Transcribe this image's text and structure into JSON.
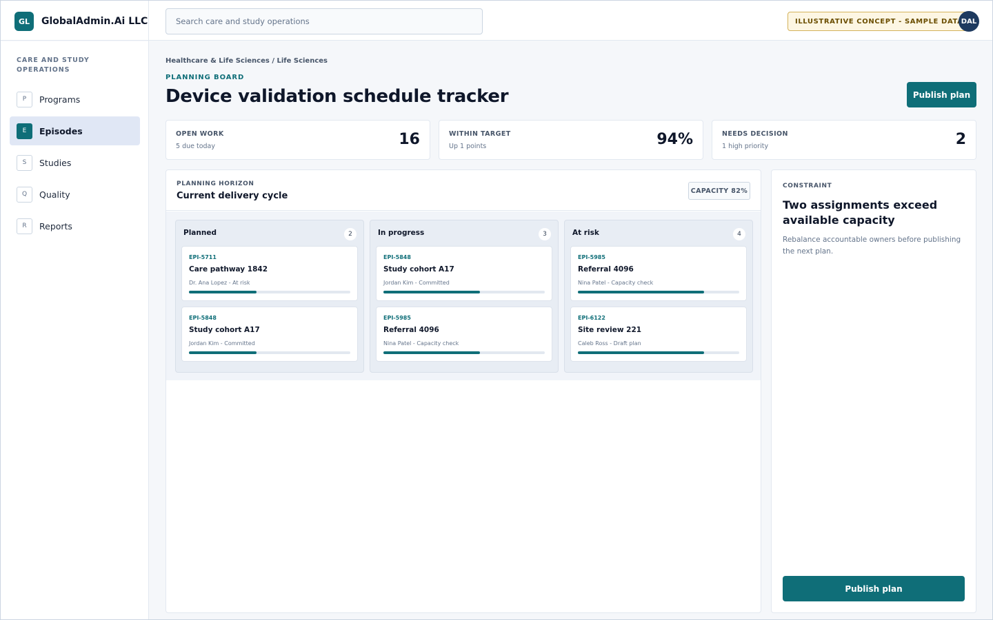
{
  "brand": {
    "mark": "GL",
    "name": "GlobalAdmin.Ai LLC"
  },
  "search": {
    "placeholder": "Search care and study operations"
  },
  "header": {
    "badge": "ILLUSTRATIVE CONCEPT - SAMPLE DATA",
    "avatar": "DAL"
  },
  "sidebar": {
    "heading": "CARE AND STUDY OPERATIONS",
    "items": [
      {
        "letter": "P",
        "label": "Programs",
        "active": false
      },
      {
        "letter": "E",
        "label": "Episodes",
        "active": true
      },
      {
        "letter": "S",
        "label": "Studies",
        "active": false
      },
      {
        "letter": "Q",
        "label": "Quality",
        "active": false
      },
      {
        "letter": "R",
        "label": "Reports",
        "active": false
      }
    ]
  },
  "main": {
    "breadcrumb": "Healthcare & Life Sciences / Life Sciences",
    "eyebrow": "PLANNING BOARD",
    "title": "Device validation schedule tracker",
    "publish_label": "Publish plan"
  },
  "stats": [
    {
      "label": "OPEN WORK",
      "sub": "5 due today",
      "value": "16"
    },
    {
      "label": "WITHIN TARGET",
      "sub": "Up 1 points",
      "value": "94%"
    },
    {
      "label": "NEEDS DECISION",
      "sub": "1 high priority",
      "value": "2"
    }
  ],
  "board": {
    "eyebrow": "PLANNING HORIZON",
    "title": "Current delivery cycle",
    "capacity": "CAPACITY 82%",
    "lanes": [
      {
        "title": "Planned",
        "count": "2",
        "cards": [
          {
            "id": "EPI-5711",
            "title": "Care pathway 1842",
            "meta": "Dr. Ana Lopez - At risk",
            "progress": 0.42
          },
          {
            "id": "EPI-5848",
            "title": "Study cohort A17",
            "meta": "Jordan Kim - Committed",
            "progress": 0.42
          }
        ]
      },
      {
        "title": "In progress",
        "count": "3",
        "cards": [
          {
            "id": "EPI-5848",
            "title": "Study cohort A17",
            "meta": "Jordan Kim - Committed",
            "progress": 0.6
          },
          {
            "id": "EPI-5985",
            "title": "Referral 4096",
            "meta": "Nina Patel - Capacity check",
            "progress": 0.6
          }
        ]
      },
      {
        "title": "At risk",
        "count": "4",
        "cards": [
          {
            "id": "EPI-5985",
            "title": "Referral 4096",
            "meta": "Nina Patel - Capacity check",
            "progress": 0.78
          },
          {
            "id": "EPI-6122",
            "title": "Site review 221",
            "meta": "Caleb Ross - Draft plan",
            "progress": 0.78
          }
        ]
      }
    ]
  },
  "constraint": {
    "eyebrow": "CONSTRAINT",
    "title": "Two assignments exceed available capacity",
    "body": "Rebalance accountable owners before publishing the next plan.",
    "publish_label": "Publish plan"
  },
  "colors": {
    "accent": "#0f6e78",
    "active_nav_bg": "#e0e7f5",
    "avatar_bg": "#1e3a5f",
    "badge_border": "#d4b25a"
  }
}
